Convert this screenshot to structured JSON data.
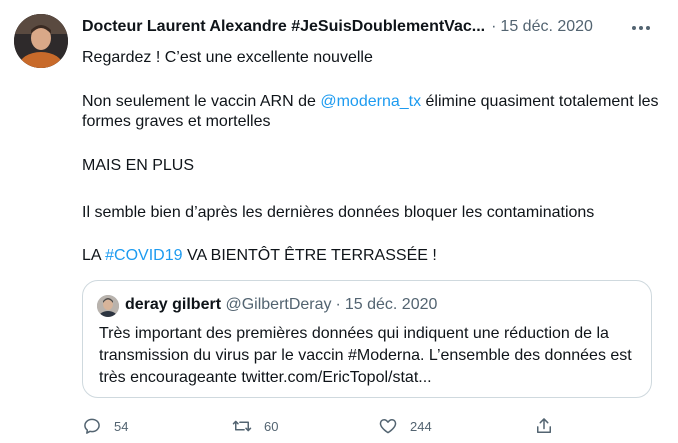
{
  "tweet": {
    "author_name": "Docteur Laurent Alexandre #JeSuisDoublementVac...",
    "separator": "·",
    "date": "15 déc. 2020",
    "lines": {
      "l1": "Regardez ! C’est une excellente nouvelle",
      "l2a": "Non seulement le vaccin ARN de ",
      "l2_mention": "@moderna_tx",
      "l2b": " élimine quasiment totalement les formes graves et mortelles",
      "l3": "MAIS EN PLUS",
      "l4": "Il semble bien d’après les dernières données bloquer les contaminations",
      "l5a": "LA ",
      "l5_hashtag": "#COVID19",
      "l5b": " VA BIENTÔT ÊTRE TERRASSÉE !"
    }
  },
  "quoted_tweet": {
    "name": "deray gilbert",
    "handle": "@GilbertDeray",
    "separator": "·",
    "date": "15 déc. 2020",
    "text": "Très important des premières données qui indiquent une réduction de la transmission du virus par le vaccin #Moderna. L’ensemble des données est très encourageante twitter.com/EricTopol/stat..."
  },
  "actions": {
    "reply_count": "54",
    "retweet_count": "60",
    "like_count": "244"
  },
  "colors": {
    "link": "#1d9bf0",
    "muted": "#536471",
    "border": "#cfd9de"
  },
  "icons": {
    "reply": "reply-icon",
    "retweet": "retweet-icon",
    "like": "heart-icon",
    "share": "share-icon",
    "more": "more-icon"
  }
}
